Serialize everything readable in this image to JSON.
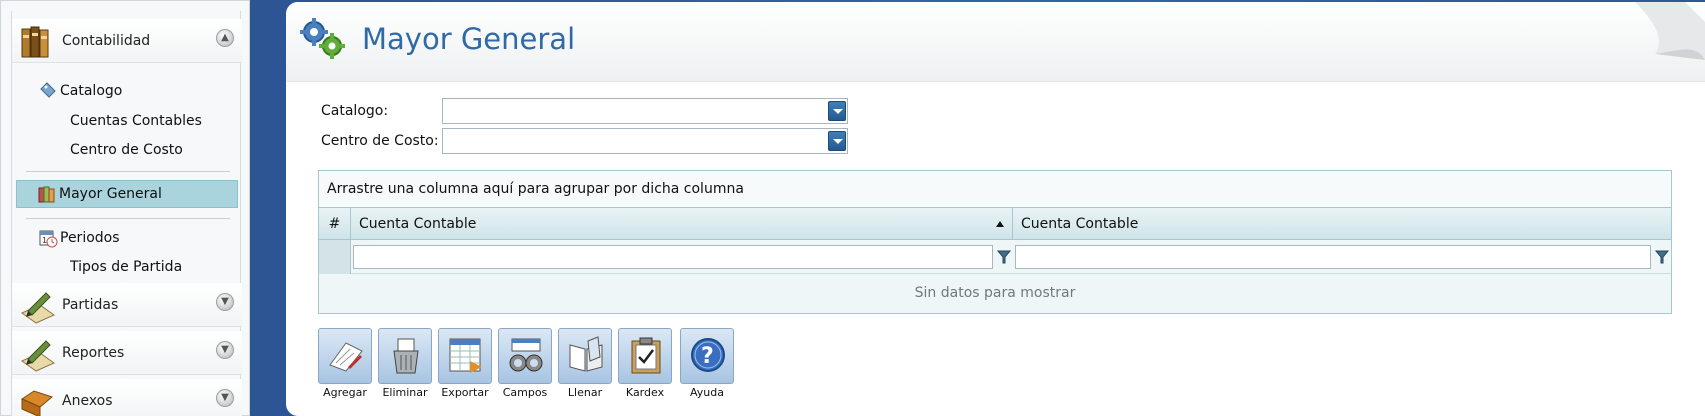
{
  "sidebar": {
    "groups": [
      {
        "label": "Contabilidad",
        "icon": "books-icon"
      },
      {
        "label": "Partidas",
        "icon": "pen-paper-icon"
      },
      {
        "label": "Reportes",
        "icon": "pen-paper-icon"
      },
      {
        "label": "Anexos",
        "icon": "folder-icon"
      }
    ],
    "items": [
      {
        "label": "Catalogo",
        "icon": "tag-icon"
      },
      {
        "label": "Cuentas Contables"
      },
      {
        "label": "Centro de Costo"
      },
      {
        "label": "Mayor General",
        "icon": "ledger-icon",
        "selected": true
      },
      {
        "label": "Periodos",
        "icon": "calendar-clock-icon"
      },
      {
        "label": "Tipos de Partida"
      }
    ]
  },
  "header": {
    "title": "Mayor General",
    "icon": "gears-icon"
  },
  "form": {
    "catalogo_label": "Catalogo:",
    "catalogo_value": "",
    "centro_label": "Centro de Costo:",
    "centro_value": ""
  },
  "grid": {
    "group_panel_text": "Arrastre una columna aquí para agrupar por dicha columna",
    "columns": [
      "#",
      "Cuenta Contable",
      "Cuenta Contable"
    ],
    "empty_text": "Sin datos para mostrar"
  },
  "toolbar": {
    "buttons": [
      {
        "label": "Agregar",
        "icon": "add-document-icon"
      },
      {
        "label": "Eliminar",
        "icon": "trash-icon"
      },
      {
        "label": "Exportar",
        "icon": "export-spreadsheet-icon"
      },
      {
        "label": "Campos",
        "icon": "binoculars-icon"
      },
      {
        "label": "Llenar",
        "icon": "open-book-icon"
      },
      {
        "label": "Kardex",
        "icon": "clipboard-check-icon"
      },
      {
        "label": "Ayuda",
        "icon": "help-icon"
      }
    ]
  },
  "colors": {
    "accent": "#2e6aa8",
    "selected": "#a9d4dd",
    "background": "#3563a8"
  }
}
